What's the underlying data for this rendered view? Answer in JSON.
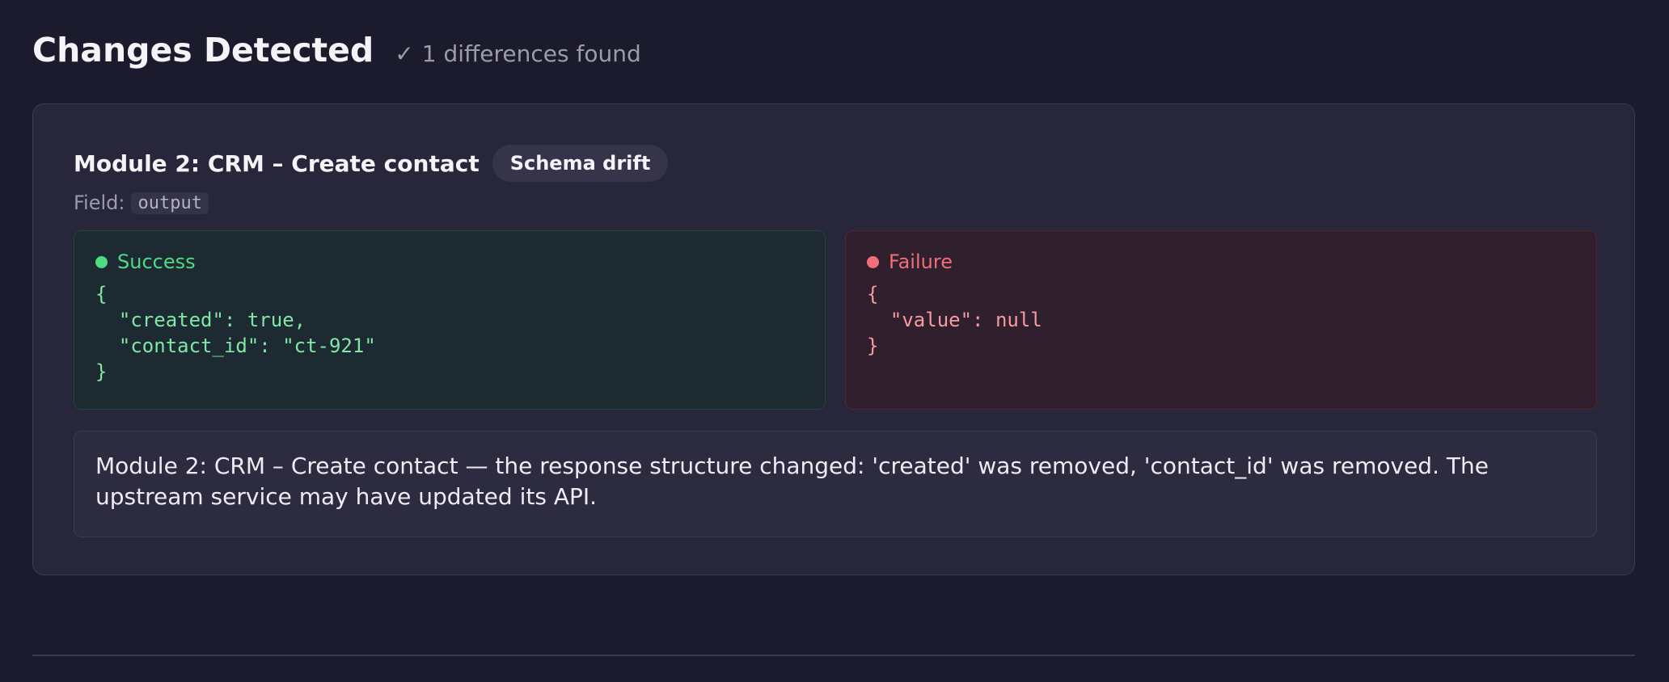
{
  "header": {
    "title": "Changes Detected",
    "check_glyph": "✓",
    "summary": "1 differences found"
  },
  "diff": {
    "module_title": "Module 2: CRM – Create contact",
    "badge": "Schema drift",
    "field_label": "Field:",
    "field_name": "output",
    "success": {
      "label": "Success",
      "json": "{\n  \"created\": true,\n  \"contact_id\": \"ct-921\"\n}"
    },
    "failure": {
      "label": "Failure",
      "json": "{\n  \"value\": null\n}"
    },
    "message": "Module 2: CRM – Create contact — the response structure changed: 'created' was removed, 'contact_id' was removed. The upstream service may have updated its API."
  },
  "colors": {
    "background": "#1c1b2e",
    "card": "#27263a",
    "success": "#4fdb82",
    "failure": "#f26e78"
  },
  "icons": {
    "check": "check-icon",
    "success_dot": "success-dot-icon",
    "failure_dot": "failure-dot-icon"
  }
}
